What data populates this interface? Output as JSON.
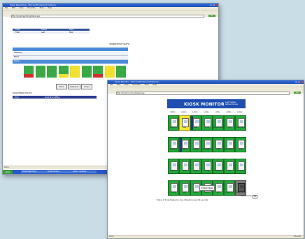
{
  "back_window": {
    "title": "Kiosk Reporting - Microsoft Internet Explorer",
    "menu": [
      "File",
      "Edit",
      "View",
      "Favorites",
      "Tools",
      "Help"
    ],
    "address": "http://kiosk/reporting/status.asp",
    "go_label": "Go",
    "summary_headers": [
      "Kiosk",
      "Status",
      "Date"
    ],
    "summary_values": [
      "Total",
      "Last",
      "Max"
    ],
    "report_title": "INTERMITTENT TRAFFIC",
    "row_labels": [
      "Gateway",
      "Batch",
      "Status"
    ],
    "bar_colors": [
      "#3aa845",
      "#3aa845",
      "#3aa845",
      "#3aa845",
      "#f0e030",
      "#3aa845",
      "#3aa845",
      "#f0e030",
      "#3aa845"
    ],
    "bar_accents": [
      "#d42b2b",
      "#3aa845",
      "#3aa845",
      "#f0e030",
      "#f0e030",
      "#3aa845",
      "#d42b2b",
      "#f0e030",
      "#3aa845"
    ],
    "buttons": [
      "Print",
      "Refresh",
      "Close"
    ],
    "section_title": "KIOSK ERROR STATUS",
    "section_bar_labels": [
      "Error",
      "Kiosk #12 Offline"
    ],
    "status": "Done",
    "start_label": "start",
    "taskbar_items": [
      "Kiosk Reporting",
      "Kiosk Monitor",
      "Inbox - Outlook"
    ]
  },
  "front_window": {
    "title": "Kiosk Monitor - Microsoft Internet Explorer",
    "menu": [
      "File",
      "Edit",
      "View",
      "Favorites",
      "Tools",
      "Help"
    ],
    "address": "http://kiosk/monitor/default.asp",
    "go_label": "Go",
    "app_title": "KIOSK MONITOR",
    "app_subtitle_lines": [
      "Last Update",
      "Refresh 60 sec"
    ],
    "column_labels": [
      "Lobby",
      "Lobby",
      "Lobby",
      "Lobby",
      "Lobby",
      "Lobby",
      "Lobby"
    ],
    "kiosks": [
      {
        "label": "Giftshop",
        "state": "green"
      },
      {
        "label": "Lab",
        "state": "yellow"
      },
      {
        "label": "Main",
        "state": "green",
        "strip": true
      },
      {
        "label": "Entry",
        "state": "green"
      },
      {
        "label": "Registration",
        "state": "green"
      },
      {
        "label": "Info",
        "state": "green"
      },
      {
        "label": "Pharmacy",
        "state": "green"
      },
      {
        "label": "Giftshop",
        "state": "green"
      },
      {
        "label": "Office",
        "state": "green",
        "strip": true
      },
      {
        "label": "Lobby",
        "state": "green"
      },
      {
        "label": "Registration",
        "state": "green"
      },
      {
        "label": "Info",
        "state": "green"
      },
      {
        "label": "Registration",
        "state": "green"
      },
      {
        "label": "Info",
        "state": "green"
      },
      {
        "label": "Giftshop",
        "state": "green"
      },
      {
        "label": "Office",
        "state": "green"
      },
      {
        "label": "Main",
        "state": "green"
      },
      {
        "label": "Entry",
        "state": "green"
      },
      {
        "label": "Registration",
        "state": "green"
      },
      {
        "label": "Info",
        "state": "green"
      },
      {
        "label": "Pharmacy",
        "state": "green"
      },
      {
        "label": "Entry",
        "state": "green"
      },
      {
        "label": "Lab",
        "state": "green"
      },
      {
        "label": "Lobby",
        "state": "green"
      },
      {
        "label": "Lobby",
        "state": "green"
      },
      {
        "label": "Info",
        "state": "green"
      },
      {
        "label": "Giftshop",
        "state": "green"
      },
      {
        "label": "Pharmacy",
        "state": "gray"
      }
    ],
    "check_button": "Check Now",
    "refresh_label": "Auto Refresh",
    "refresh_value": "60",
    "footnote": "Status of Kiosk Network is live refreshed every 60 seconds.",
    "status": "Done",
    "zone": "Internet"
  }
}
